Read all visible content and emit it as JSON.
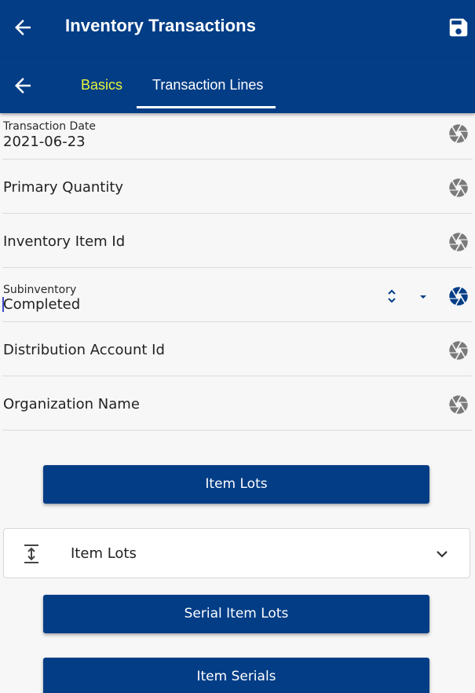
{
  "header": {
    "title": "Inventory Transactions",
    "back_icon": "arrow-left-icon",
    "save_icon": "floppy-disk-icon"
  },
  "tabs": {
    "back_icon": "arrow-left-icon",
    "items": [
      {
        "label": "Basics",
        "active": false
      },
      {
        "label": "Transaction Lines",
        "active": true
      }
    ]
  },
  "fields": {
    "transaction_date": {
      "label": "Transaction Date",
      "value": "2021-06-23"
    },
    "primary_quantity": {
      "label": "Primary Quantity"
    },
    "inventory_item_id": {
      "label": "Inventory Item Id"
    },
    "subinventory": {
      "label": "Subinventory",
      "value": "Completed"
    },
    "distribution_account_id": {
      "label": "Distribution Account Id"
    },
    "organization_name": {
      "label": "Organization Name"
    }
  },
  "buttons": {
    "item_lots": "Item Lots",
    "serial_item_lots": "Serial Item Lots",
    "item_serials": "Item Serials"
  },
  "expander": {
    "label": "Item Lots",
    "icon": "expand-vertical-icon",
    "chevron": "chevron-down-icon"
  },
  "colors": {
    "primary": "#023d86",
    "active_tab_text": "#ffffff",
    "inactive_tab_text": "#e9f53c",
    "aperture_gray": "#7a7a7a",
    "aperture_active": "#023d86"
  }
}
